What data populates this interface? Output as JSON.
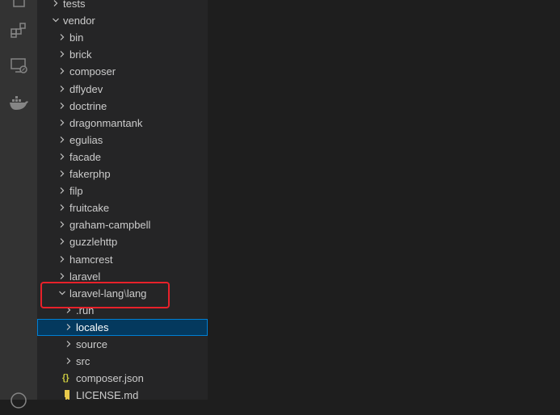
{
  "activity_bar": {
    "icons": [
      "explorer-icon",
      "extensions-icon",
      "remote-explorer-icon",
      "docker-icon",
      "accounts-icon"
    ]
  },
  "explorer": {
    "tests": "tests",
    "vendor": "vendor",
    "vendor_children": [
      "bin",
      "brick",
      "composer",
      "dflydev",
      "doctrine",
      "dragonmantank",
      "egulias",
      "facade",
      "fakerphp",
      "filp",
      "fruitcake",
      "graham-campbell",
      "guzzlehttp",
      "hamcrest",
      "laravel"
    ],
    "laravel_lang": {
      "part1": "laravel-lang",
      "separator": "\\",
      "part2": "lang"
    },
    "lang_children": {
      "run": ".run",
      "locales": "locales",
      "source": "source",
      "src": "src",
      "composer_json": "composer.json",
      "license_md": "LICENSE.md"
    },
    "icons": {
      "json_glyph": "{}"
    }
  },
  "colors": {
    "highlight_border": "#e8212a",
    "selected_bg": "#04395e",
    "json_icon": "#cbcb41",
    "license_icon": "#e8c94b"
  }
}
